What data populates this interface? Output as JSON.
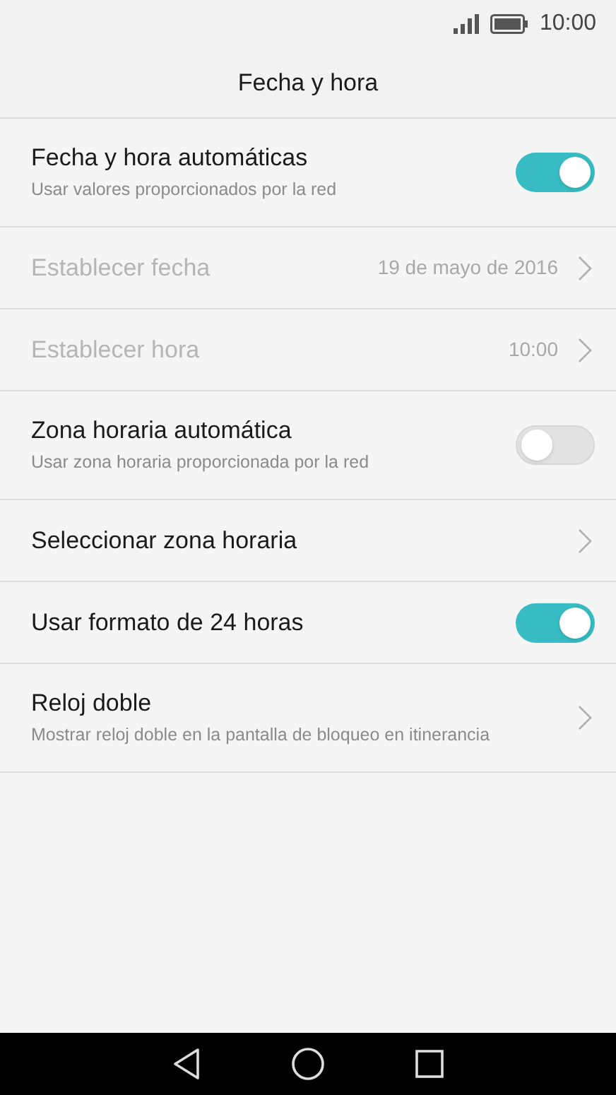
{
  "status_bar": {
    "time": "10:00"
  },
  "title": "Fecha y hora",
  "settings": [
    {
      "kind": "toggle",
      "label": "Fecha y hora automáticas",
      "subtitle": "Usar valores proporcionados por la red",
      "on": true,
      "disabled": false
    },
    {
      "kind": "value",
      "label": "Establecer fecha",
      "value": "19 de mayo de 2016",
      "disabled": true
    },
    {
      "kind": "value",
      "label": "Establecer hora",
      "value": "10:00",
      "disabled": true
    },
    {
      "kind": "toggle",
      "label": "Zona horaria automática",
      "subtitle": "Usar zona horaria proporcionada por la red",
      "on": false,
      "disabled": false
    },
    {
      "kind": "value",
      "label": "Seleccionar zona horaria",
      "disabled": false
    },
    {
      "kind": "toggle",
      "label": "Usar formato de 24 horas",
      "on": true,
      "disabled": false
    },
    {
      "kind": "value",
      "label": "Reloj doble",
      "subtitle": "Mostrar reloj doble en la pantalla de bloqueo en itinerancia",
      "disabled": false
    }
  ]
}
